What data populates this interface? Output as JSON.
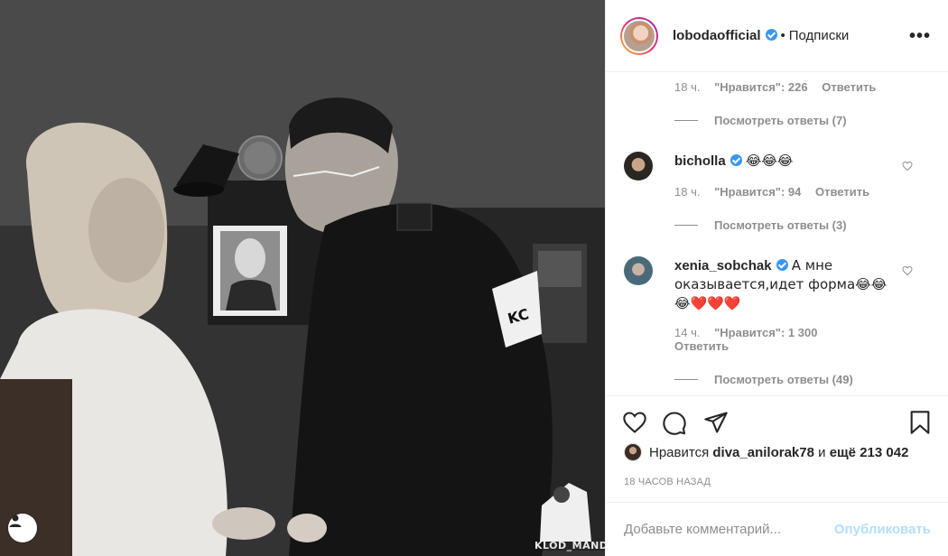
{
  "post": {
    "watermark": "KLOD_MANDE",
    "image_description_icon": "user-silhouette-icon"
  },
  "header": {
    "username": "lobodaofficial",
    "separator": "•",
    "follow_label": "Подписки",
    "more_icon": "ellipsis-icon"
  },
  "comments": {
    "top_meta": {
      "time": "18 ч.",
      "likes": "\"Нравится\": 226",
      "reply": "Ответить"
    },
    "top_view_replies": "Посмотреть ответы (7)",
    "items": [
      {
        "username": "bicholla",
        "text": "😂😂😂",
        "time": "18 ч.",
        "likes": "\"Нравится\": 94",
        "reply": "Ответить",
        "view_replies": "Посмотреть ответы (3)"
      },
      {
        "username": "xenia_sobchak",
        "text": "А мне оказывается,идет форма😂😂😂❤️❤️❤️",
        "time": "14 ч.",
        "likes": "\"Нравится\": 1 300",
        "reply": "Ответить",
        "view_replies": "Посмотреть ответы (49)"
      }
    ]
  },
  "likes": {
    "prefix": "Нравится",
    "user": "diva_anilorak78",
    "connector": "и",
    "others": "ещё 213 042"
  },
  "time_ago": "18 ЧАСОВ НАЗАД",
  "add_comment": {
    "placeholder": "Добавьте комментарий...",
    "publish": "Опубликовать"
  },
  "colors": {
    "verified": "#3897f0",
    "publish_disabled": "#b2dffc",
    "meta_gray": "#8e8e8e"
  }
}
